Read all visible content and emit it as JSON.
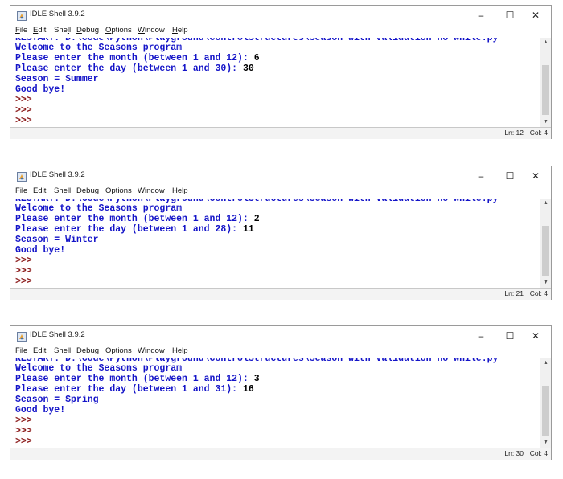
{
  "windows": [
    {
      "title": "IDLE Shell 3.9.2",
      "menu": [
        "File",
        "Edit",
        "Shell",
        "Debug",
        "Options",
        "Window",
        "Help"
      ],
      "mnemonics": [
        "F",
        "E",
        "l",
        "D",
        "O",
        "W",
        "H"
      ],
      "controls": {
        "minimize": "–",
        "maximize": "☐",
        "close": "✕"
      },
      "partial_line": "RESTART: D:\\Code\\Python\\Playground\\ControlStructures\\Season with validation no while.py",
      "lines": {
        "welcome": "Welcome to the Seasons program",
        "month_prompt": "Please enter the month (between 1 and 12): ",
        "month_value": "6",
        "day_prompt": "Please enter the day (between 1 and 30): ",
        "day_value": "30",
        "season": "Season = Summer",
        "bye": "Good bye!"
      },
      "prompts": [
        ">>>",
        ">>>",
        ">>>"
      ],
      "status": {
        "ln": "Ln: 12",
        "col": "Col: 4"
      }
    },
    {
      "title": "IDLE Shell 3.9.2",
      "menu": [
        "File",
        "Edit",
        "Shell",
        "Debug",
        "Options",
        "Window",
        "Help"
      ],
      "mnemonics": [
        "F",
        "E",
        "l",
        "D",
        "O",
        "W",
        "H"
      ],
      "controls": {
        "minimize": "–",
        "maximize": "☐",
        "close": "✕"
      },
      "partial_line": "RESTART: D:\\Code\\Python\\Playground\\ControlStructures\\Season with validation no while.py",
      "lines": {
        "welcome": "Welcome to the Seasons program",
        "month_prompt": "Please enter the month (between 1 and 12): ",
        "month_value": "2",
        "day_prompt": "Please enter the day (between 1 and 28): ",
        "day_value": "11",
        "season": "Season = Winter",
        "bye": "Good bye!"
      },
      "prompts": [
        ">>>",
        ">>>",
        ">>>"
      ],
      "status": {
        "ln": "Ln: 21",
        "col": "Col: 4"
      }
    },
    {
      "title": "IDLE Shell 3.9.2",
      "menu": [
        "File",
        "Edit",
        "Shell",
        "Debug",
        "Options",
        "Window",
        "Help"
      ],
      "mnemonics": [
        "F",
        "E",
        "l",
        "D",
        "O",
        "W",
        "H"
      ],
      "controls": {
        "minimize": "–",
        "maximize": "☐",
        "close": "✕"
      },
      "partial_line": "RESTART: D:\\Code\\Python\\Playground\\ControlStructures\\Season with validation no while.py",
      "lines": {
        "welcome": "Welcome to the Seasons program",
        "month_prompt": "Please enter the month (between 1 and 12): ",
        "month_value": "3",
        "day_prompt": "Please enter the day (between 1 and 31): ",
        "day_value": "16",
        "season": "Season = Spring",
        "bye": "Good bye!"
      },
      "prompts": [
        ">>>",
        ">>>",
        ">>>"
      ],
      "status": {
        "ln": "Ln: 30",
        "col": "Col: 4"
      }
    }
  ]
}
